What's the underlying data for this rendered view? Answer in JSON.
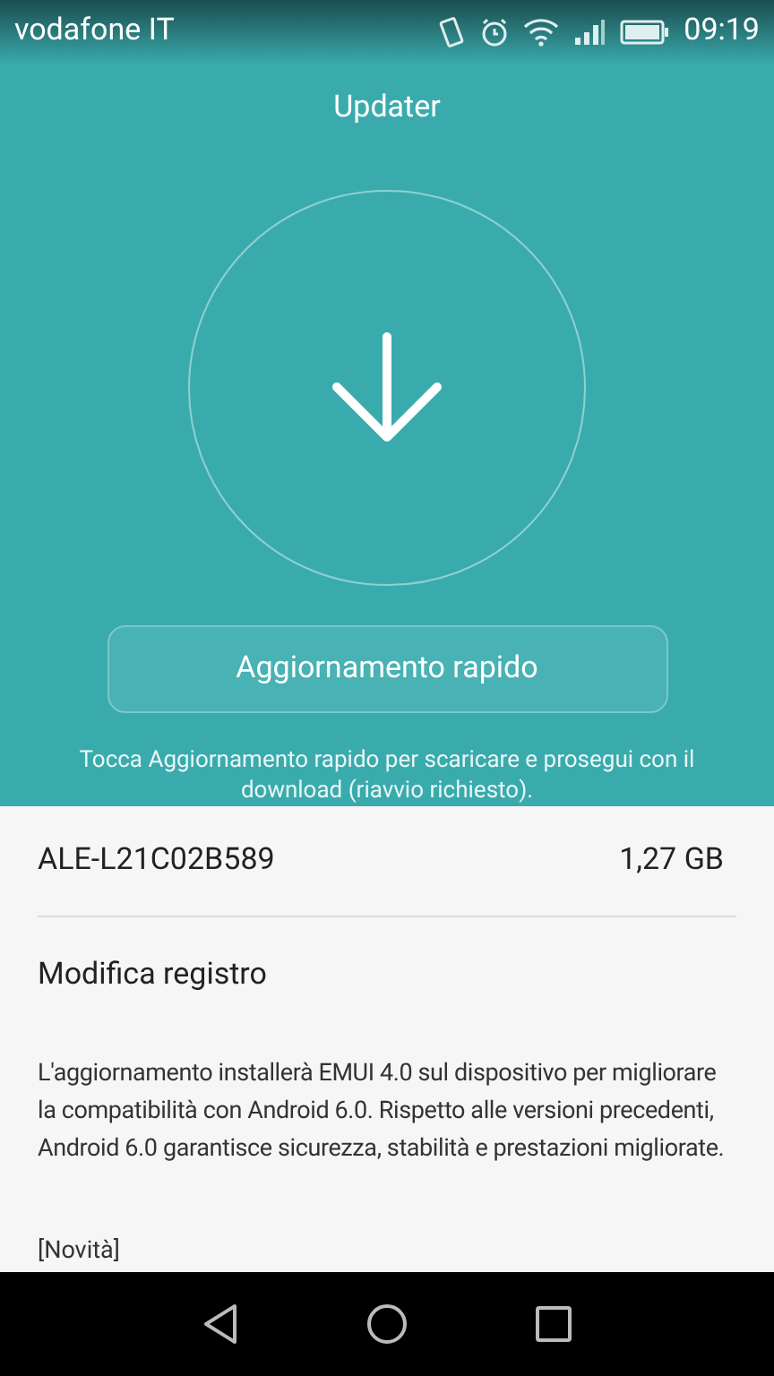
{
  "status_bar": {
    "carrier": "vodafone IT",
    "time": "09:19"
  },
  "header": {
    "title": "Updater"
  },
  "quick_update_button": {
    "label": "Aggiornamento rapido"
  },
  "hint": "Tocca Aggiornamento rapido per scaricare e prosegui con il download (riavvio richiesto).",
  "package": {
    "name": "ALE-L21C02B589",
    "size": "1,27 GB"
  },
  "changelog": {
    "title": "Modifica registro",
    "description": "L'aggiornamento installerà EMUI 4.0 sul dispositivo per migliorare la compatibilità con Android 6.0. Rispetto alle versioni precedenti, Android 6.0 garantisce sicurezza, stabilità e prestazioni migliorate.",
    "section": "[Novità]"
  }
}
